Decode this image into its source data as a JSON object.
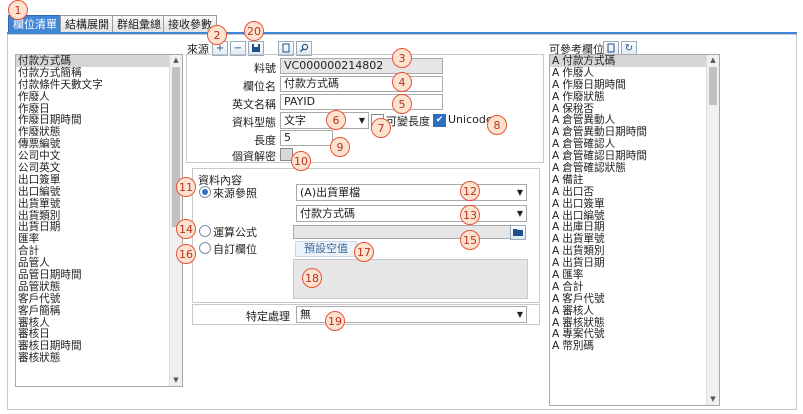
{
  "tabs": [
    "欄位清單",
    "結構展開",
    "群組彙總",
    "接收參數"
  ],
  "toolbar": {
    "source_label": "來源",
    "add_icon": "+",
    "remove_icon": "−",
    "save_icon": "save-icon",
    "copy_icon": "copy-icon",
    "search_icon": "search-icon"
  },
  "left_list": [
    "付款方式碼",
    "付款方式簡稱",
    "付款條件天數文字",
    "作廢人",
    "作廢日",
    "作廢日期時間",
    "作廢狀態",
    "傳票編號",
    "公司中文",
    "公司英文",
    "出口簽單",
    "出口編號",
    "出貨單號",
    "出貨類別",
    "出貨日期",
    "匯率",
    "合計",
    "品管人",
    "品管日期時間",
    "品管狀態",
    "客戶代號",
    "客戶簡稱",
    "審核人",
    "審核日",
    "審核日期時間",
    "審核狀態"
  ],
  "form": {
    "code_label": "料號",
    "code_value": "VC000000214802",
    "field_name_label": "欄位名",
    "field_name_value": "付款方式碼",
    "english_label": "英文名稱",
    "english_value": "PAYID",
    "type_label": "資料型態",
    "type_value": "文字",
    "variable_length_label": "可變長度",
    "unicode_label": "Unicode",
    "length_label": "長度",
    "length_value": "5",
    "decrypt_label": "個資解密",
    "content_group_label": "資料內容",
    "source_ref_label": "來源參照",
    "source_table_value": "(A)出貨單檔",
    "source_field_value": "付款方式碼",
    "formula_label": "運算公式",
    "custom_label": "自訂欄位",
    "default_btn_label": "預設空值",
    "special_label": "特定處理",
    "special_value": "無"
  },
  "right_header": "可參考欄位",
  "right_list": [
    "付款方式碼",
    "作廢人",
    "作廢日期時間",
    "作廢狀態",
    "保稅否",
    "倉管異動人",
    "倉管異動日期時間",
    "倉管確認人",
    "倉管確認日期時間",
    "倉管確認狀態",
    "備註",
    "出口否",
    "出口簽單",
    "出口編號",
    "出庫日期",
    "出貨單號",
    "出貨類別",
    "出貨日期",
    "匯率",
    "合計",
    "客戶代號",
    "審核人",
    "審核狀態",
    "專案代號",
    "幣別碼"
  ],
  "right_prefix": "A",
  "badges": [
    "1",
    "2",
    "20",
    "3",
    "4",
    "5",
    "6",
    "7",
    "8",
    "9",
    "10",
    "11",
    "12",
    "13",
    "14",
    "15",
    "16",
    "17",
    "18",
    "19"
  ],
  "colors": {
    "accent": "#3f86d6",
    "badge_border": "#e8513a",
    "badge_fill": "#fbe3cf"
  }
}
